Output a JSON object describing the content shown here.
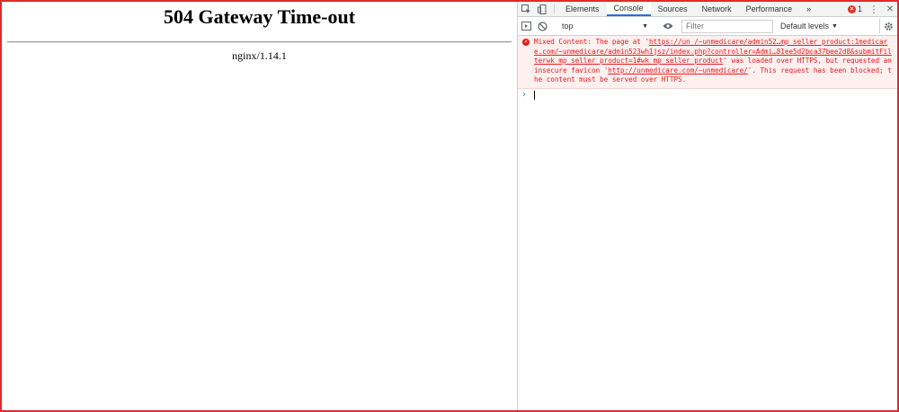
{
  "page": {
    "heading": "504 Gateway Time-out",
    "server": "nginx/1.14.1"
  },
  "devtools": {
    "tabs": [
      "Elements",
      "Console",
      "Sources",
      "Network",
      "Performance"
    ],
    "active_tab": "Console",
    "more_tabs": "»",
    "error_count": "1",
    "error_glyph": "×",
    "more_menu": "⋮",
    "close": "✕",
    "context": "top",
    "filter_placeholder": "Filter",
    "levels": "Default levels",
    "message": {
      "prefix": "Mixed Content: The page at '",
      "link1": "https://un /~unmedicare/admin52…mp_seller_product:1medicare.com/~unmedicare/admin523wh1jsz/index.php?controller=Admi…81ee5d2bca37bee2d8&submitFilterwk_mp_seller_product=1#wk_mp_seller_product",
      "middle": "' was loaded over HTTPS, but requested an insecure favicon '",
      "link2": "http://unmedicare.com/~unmedicare/",
      "suffix": "'. This request has been blocked; the content must be served over HTTPS."
    },
    "prompt_symbol": "›"
  },
  "colors": {
    "frame_border": "#e02b2b",
    "error_text": "#e31c1c",
    "error_bg": "#fff0f0",
    "active_tab_underline": "#1a73e8"
  }
}
